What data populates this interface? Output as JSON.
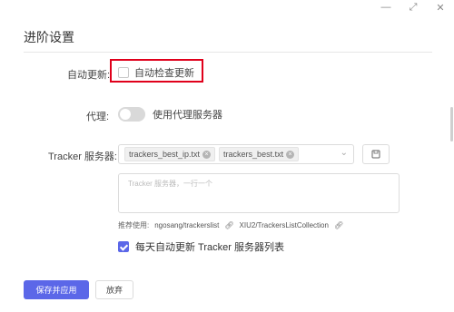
{
  "window": {
    "minimize_glyph": "—",
    "restore_glyph": "⤢",
    "close_glyph": "✕"
  },
  "page": {
    "title": "进阶设置"
  },
  "auto_update": {
    "label": "自动更新:",
    "checkbox_label": "自动检查更新",
    "checked": false
  },
  "proxy": {
    "label": "代理:",
    "toggle_label": "使用代理服务器",
    "enabled": false
  },
  "tracker": {
    "label": "Tracker 服务器:",
    "selected": [
      "trackers_best_ip.txt",
      "trackers_best.txt"
    ],
    "save_icon": "save-icon",
    "textarea_placeholder": "Tracker 服务器，一行一个",
    "recommend_prefix": "推荐使用:",
    "recommend_links": [
      "ngosang/trackerslist",
      "XIU2/TrackersListCollection"
    ],
    "daily_update_label": "每天自动更新 Tracker 服务器列表",
    "daily_update_checked": true
  },
  "actions": {
    "save_apply": "保存并应用",
    "discard": "放弃"
  },
  "colors": {
    "accent": "#5b67e8",
    "highlight": "#e0001b"
  }
}
